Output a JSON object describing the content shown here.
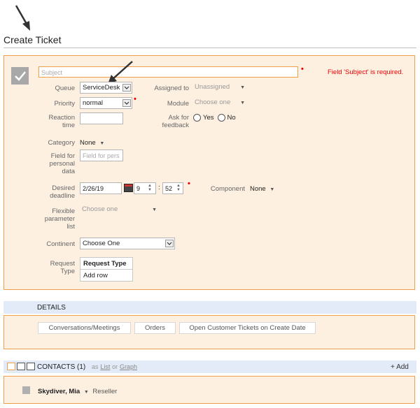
{
  "page": {
    "title": "Create Ticket"
  },
  "form": {
    "subject_placeholder": "Subject",
    "subject_error": "Field 'Subject' is required.",
    "queue": {
      "label": "Queue",
      "value": "ServiceDesk"
    },
    "assigned_to": {
      "label": "Assigned to",
      "value": "Unassigned"
    },
    "priority": {
      "label": "Priority",
      "value": "normal"
    },
    "module": {
      "label": "Module",
      "value": "Choose one"
    },
    "reaction_time": {
      "label_line1": "Reaction",
      "label_line2": "time",
      "value": ""
    },
    "ask_feedback": {
      "label_line1": "Ask for",
      "label_line2": "feedback",
      "yes": "Yes",
      "no": "No"
    },
    "category": {
      "label": "Category",
      "value": "None"
    },
    "personal_data": {
      "label_line1": "Field for",
      "label_line2": "personal",
      "label_line3": "data",
      "placeholder": "Field for pers"
    },
    "deadline": {
      "label_line1": "Desired",
      "label_line2": "deadline",
      "date": "2/26/19",
      "hour": "9",
      "sep": ":",
      "minute": "52"
    },
    "component": {
      "label": "Component",
      "value": "None"
    },
    "flexible": {
      "label_line1": "Flexible",
      "label_line2": "parameter",
      "label_line3": "list",
      "value": "Choose one"
    },
    "continent": {
      "label": "Continent",
      "value": "Choose One"
    },
    "request_type": {
      "label_line1": "Request",
      "label_line2": "Type",
      "header": "Request Type",
      "add_row": "Add row"
    }
  },
  "details": {
    "title": "DETAILS",
    "tabs": [
      "Conversations/Meetings",
      "Orders",
      "Open Customer Tickets on Create Date"
    ]
  },
  "contacts": {
    "title": "CONTACTS (1)",
    "as": "as",
    "list": "List",
    "or": "or",
    "graph": "Graph",
    "add": "+ Add",
    "items": [
      {
        "name": "Skydiver, Mia",
        "role": "Reseller"
      }
    ]
  },
  "colors": {
    "panel_bg": "#fdf0e1",
    "panel_border": "#f0a04a",
    "bar_bg": "#e2ebf7",
    "error": "#e00000"
  }
}
